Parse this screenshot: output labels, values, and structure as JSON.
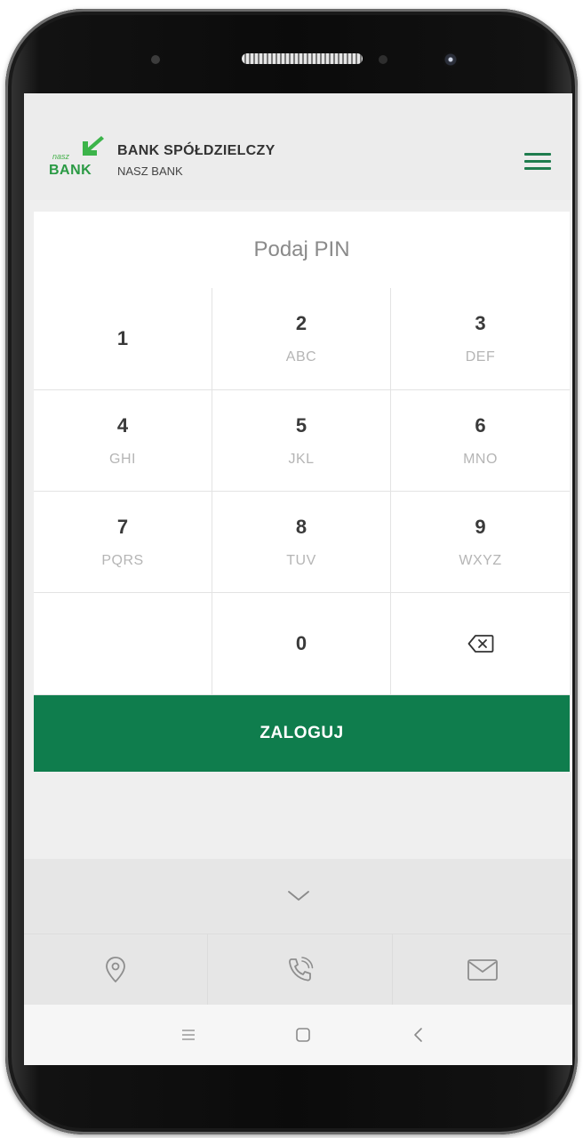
{
  "header": {
    "logo_small": "nasz",
    "logo_word": "BANK",
    "bank_name": "BANK SPÓŁDZIELCZY",
    "bank_subtitle": "NASZ BANK"
  },
  "pin": {
    "title": "Podaj PIN"
  },
  "keypad": [
    {
      "digit": "1",
      "letters": ""
    },
    {
      "digit": "2",
      "letters": "ABC"
    },
    {
      "digit": "3",
      "letters": "DEF"
    },
    {
      "digit": "4",
      "letters": "GHI"
    },
    {
      "digit": "5",
      "letters": "JKL"
    },
    {
      "digit": "6",
      "letters": "MNO"
    },
    {
      "digit": "7",
      "letters": "PQRS"
    },
    {
      "digit": "8",
      "letters": "TUV"
    },
    {
      "digit": "9",
      "letters": "WXYZ"
    },
    {
      "digit": "",
      "letters": ""
    },
    {
      "digit": "0",
      "letters": ""
    }
  ],
  "login": {
    "label": "ZALOGUJ"
  },
  "icons": {
    "menu": "hamburger-menu-icon",
    "backspace": "backspace-icon",
    "expand": "chevron-down-icon",
    "location": "location-pin-icon",
    "phone": "phone-icon",
    "mail": "mail-icon"
  },
  "colors": {
    "brand_green": "#0f7d4d",
    "logo_green": "#2a9a44"
  }
}
